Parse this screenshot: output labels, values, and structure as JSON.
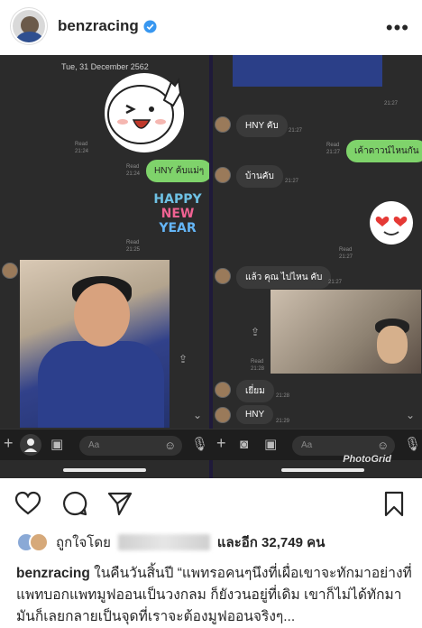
{
  "post": {
    "username": "benzracing",
    "more_label": "•••",
    "likes_prefix": "ถูกใจโดย",
    "likes_suffix": "และอีก 32,749 คน",
    "caption_user": "benzracing",
    "caption_text": "ในคืนวันสิ้นปี “แพทรอคนๆนึงที่เผื่อเขาจะทักมาอย่างที่แพทบอกแพทมูฟออนเป็นวงกลม ก็ยังวนอยู่ที่เดิม เขาก็ไม่ได้ทักมา มันก็เลยกลายเป็นจุดที่เราจะต้องมูฟออนจริงๆ..."
  },
  "chat_left": {
    "date": "Tue, 31 December 2562",
    "read_1": "Read",
    "time_1": "21:24",
    "read_2": "Read",
    "time_2": "21:24",
    "bubble_hny_mom": "HNY ค้บแม่ๆ",
    "read_3": "Read",
    "time_3": "21:25",
    "hny_line1": "HAPPY",
    "hny_line2": "NEW",
    "hny_line3": "YEAR"
  },
  "chat_right": {
    "time_0": "21:27",
    "msg_hny": "HNY คับ",
    "time_1": "21:27",
    "msg_countdown": "เค้าดาวน์ไหนกัน",
    "read_1": "Read",
    "time_2": "21:27",
    "msg_home": "บ้านคับ",
    "time_3": "21:27",
    "read_2": "Read",
    "time_4": "21:27",
    "msg_where": "แล้ว คุณ ไปไหน คับ",
    "time_5": "21:27",
    "read_3": "Read",
    "time_6": "21:28",
    "msg_ok": "เยี่ยม",
    "time_7": "21:28",
    "msg_hny2": "HNY",
    "time_8": "21:29",
    "input_placeholder": "Aa",
    "watermark": "PhotoGrid"
  },
  "input_left": {
    "placeholder": "Aa"
  },
  "colors": {
    "line_green": "#7fd36b",
    "chat_bg": "#2b2b2b",
    "verified_blue": "#3897f0"
  }
}
